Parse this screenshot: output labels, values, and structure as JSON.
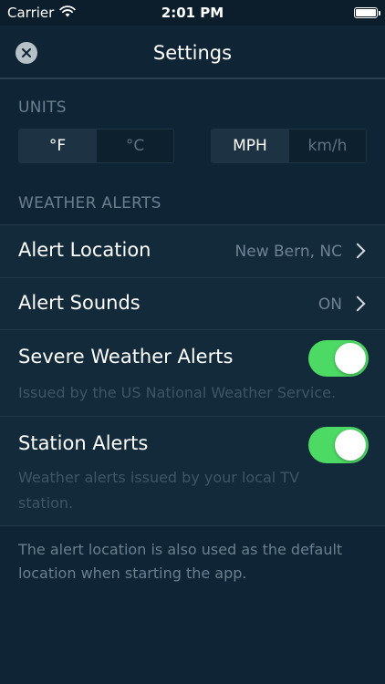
{
  "status_bar": {
    "carrier": "Carrier",
    "time": "2:01 PM",
    "battery_level_percent": 100
  },
  "nav": {
    "title": "Settings",
    "close_icon": "close-x-icon"
  },
  "units": {
    "header": "UNITS",
    "temperature": {
      "options": [
        "°F",
        "°C"
      ],
      "selected": "°F"
    },
    "speed": {
      "options": [
        "MPH",
        "km/h"
      ],
      "selected": "MPH"
    }
  },
  "weather_alerts": {
    "header": "WEATHER ALERTS",
    "alert_location": {
      "label": "Alert Location",
      "value": "New Bern, NC"
    },
    "alert_sounds": {
      "label": "Alert Sounds",
      "value": "ON"
    },
    "severe_weather_alerts": {
      "label": "Severe Weather Alerts",
      "description": "Issued by the US National Weather Service.",
      "enabled": true
    },
    "station_alerts": {
      "label": "Station Alerts",
      "description_line1": "Weather alerts issued by your local TV",
      "description_line2": "station.",
      "enabled": true
    }
  },
  "footer": {
    "line1": "The alert location is also used as the default",
    "line2": "location when starting the app."
  },
  "colors": {
    "background": "#0f2434",
    "row_background": "#132a3b",
    "toggle_on": "#4cd964",
    "muted_text": "#6b7f8e"
  }
}
